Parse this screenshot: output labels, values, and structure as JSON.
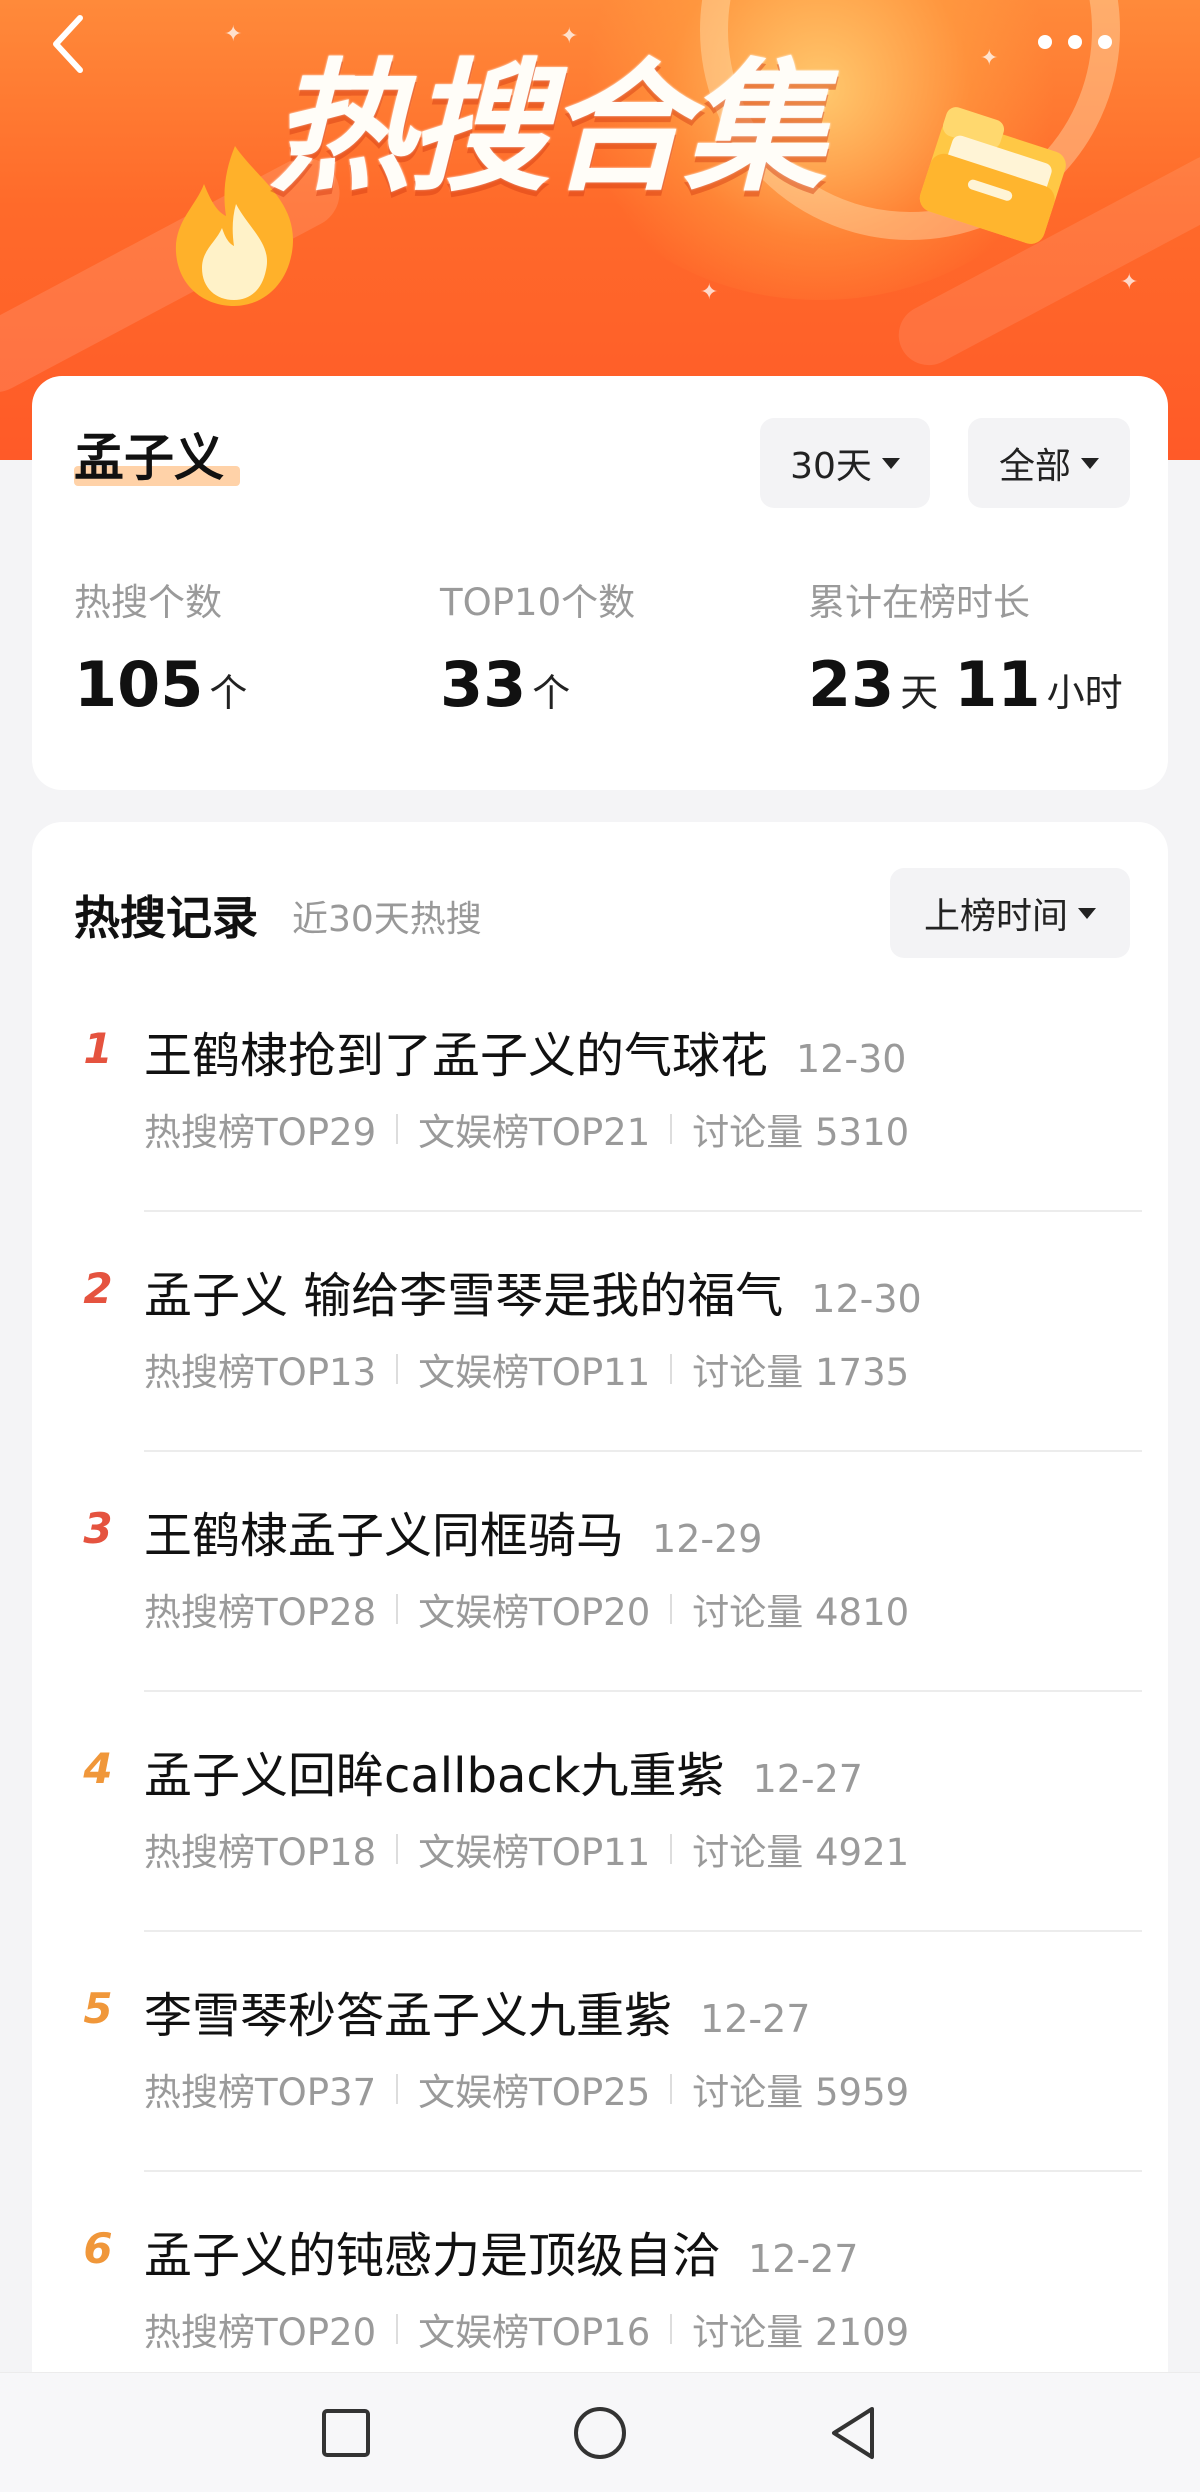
{
  "header": {
    "title": "热搜合集",
    "back_icon": "chevron-left-icon",
    "more_icon": "more-dots-icon",
    "colors": {
      "banner": "#ff6a2a",
      "banner_light": "#ffb347"
    }
  },
  "summary": {
    "person_name": "孟子义",
    "filters": {
      "days": "30天",
      "scope": "全部"
    },
    "stats": [
      {
        "label": "热搜个数",
        "value": "105",
        "unit": "个"
      },
      {
        "label": "TOP10个数",
        "value": "33",
        "unit": "个"
      },
      {
        "label": "累计在榜时长",
        "value_days": "23",
        "unit_days": "天",
        "value_hours": "11",
        "unit_hours": "小时"
      }
    ]
  },
  "records": {
    "title": "热搜记录",
    "subtitle": "近30天热搜",
    "sort_label": "上榜时间",
    "items": [
      {
        "rank": "1",
        "title": "王鹤棣抢到了孟子义的气球花",
        "date": "12-30",
        "hot_rank": "热搜榜TOP29",
        "ent_rank": "文娱榜TOP21",
        "discussion": "讨论量 5310"
      },
      {
        "rank": "2",
        "title": "孟子义 输给李雪琴是我的福气",
        "date": "12-30",
        "hot_rank": "热搜榜TOP13",
        "ent_rank": "文娱榜TOP11",
        "discussion": "讨论量 1735"
      },
      {
        "rank": "3",
        "title": "王鹤棣孟子义同框骑马",
        "date": "12-29",
        "hot_rank": "热搜榜TOP28",
        "ent_rank": "文娱榜TOP20",
        "discussion": "讨论量 4810"
      },
      {
        "rank": "4",
        "title": "孟子义回眸callback九重紫",
        "date": "12-27",
        "hot_rank": "热搜榜TOP18",
        "ent_rank": "文娱榜TOP11",
        "discussion": "讨论量 4921"
      },
      {
        "rank": "5",
        "title": "李雪琴秒答孟子义九重紫",
        "date": "12-27",
        "hot_rank": "热搜榜TOP37",
        "ent_rank": "文娱榜TOP25",
        "discussion": "讨论量 5959"
      },
      {
        "rank": "6",
        "title": "孟子义的钝感力是顶级自洽",
        "date": "12-27",
        "hot_rank": "热搜榜TOP20",
        "ent_rank": "文娱榜TOP16",
        "discussion": "讨论量 2109"
      }
    ],
    "colors": {
      "rank_top": "#e5533f",
      "rank_other": "#f0973a"
    }
  },
  "navbar": {
    "icons": [
      "recent-apps-icon",
      "home-icon",
      "back-icon"
    ]
  }
}
